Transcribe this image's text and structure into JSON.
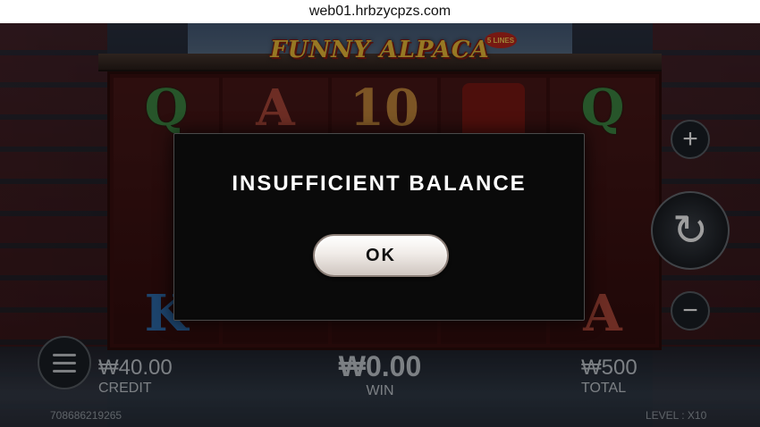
{
  "browser": {
    "url": "web01.hrbzycpzs.com"
  },
  "game": {
    "title": "FUNNY ALPACA",
    "lines_badge": "5 LINES",
    "reels": [
      [
        "Q",
        "",
        "K"
      ],
      [
        "A",
        "",
        ""
      ],
      [
        "10",
        "",
        ""
      ],
      [
        "",
        "",
        ""
      ],
      [
        "Q",
        "",
        "A"
      ]
    ],
    "controls": {
      "plus_icon": "plus-icon",
      "spin_icon": "spin-icon",
      "minus_icon": "minus-icon",
      "menu_icon": "menu-icon"
    },
    "credit": {
      "value": "₩40.00",
      "label": "CREDIT"
    },
    "win": {
      "value": "₩0.00",
      "label": "WIN"
    },
    "total": {
      "value": "₩500",
      "label": "TOTAL"
    },
    "account_id": "708686219265",
    "level": "LEVEL : X10"
  },
  "dialog": {
    "message": "INSUFFICIENT BALANCE",
    "ok_label": "OK"
  }
}
